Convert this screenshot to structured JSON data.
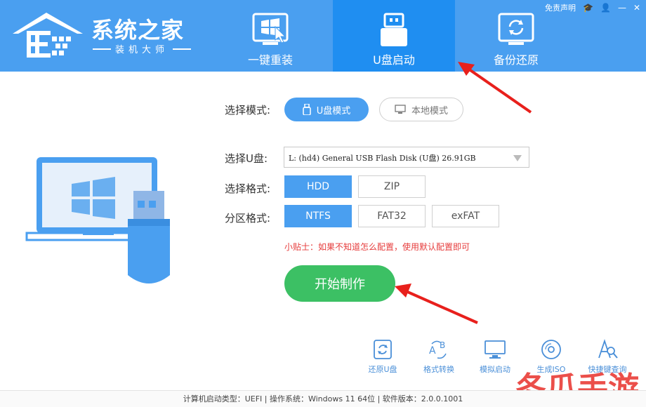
{
  "app": {
    "title": "系统之家",
    "subtitle": "装机大师"
  },
  "header": {
    "links": [
      "免责声明"
    ],
    "tabs": [
      {
        "label": "一键重装"
      },
      {
        "label": "U盘启动"
      },
      {
        "label": "备份还原"
      }
    ]
  },
  "main": {
    "mode": {
      "label": "选择模式:",
      "usb_mode": "U盘模式",
      "local_mode": "本地模式"
    },
    "disk": {
      "label": "选择U盘:",
      "value": "L: (hd4) General USB Flash Disk  (U盘) 26.91GB"
    },
    "format": {
      "label": "选择格式:",
      "options": [
        "HDD",
        "ZIP"
      ]
    },
    "partition": {
      "label": "分区格式:",
      "options": [
        "NTFS",
        "FAT32",
        "exFAT"
      ]
    },
    "tip": "小贴士：如果不知道怎么配置，使用默认配置即可",
    "start_button": "开始制作"
  },
  "tools": [
    {
      "label": "还原U盘"
    },
    {
      "label": "格式转换"
    },
    {
      "label": "模拟启动"
    },
    {
      "label": "生成ISO"
    },
    {
      "label": "快捷键查询"
    }
  ],
  "status": {
    "text": "计算机启动类型：UEFI | 操作系统：Windows 11 64位 | 软件版本：2.0.0.1001"
  },
  "watermark": {
    "text": "冬瓜手游"
  },
  "colors": {
    "header_blue": "#4a9ff0",
    "active_tab": "#1f8ef1",
    "accent": "#4a9ff0",
    "start_green": "#3cc064",
    "tip_red": "#e63c3c",
    "arrow_red": "#e8201c"
  }
}
